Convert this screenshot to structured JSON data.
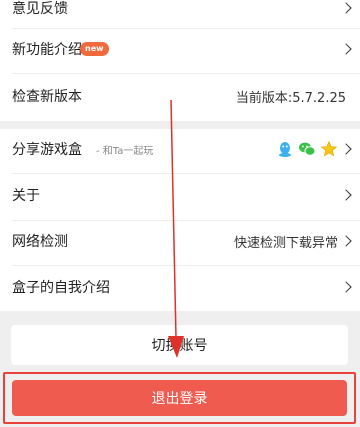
{
  "settings": {
    "feedback": {
      "label": "意见反馈"
    },
    "new_features": {
      "label": "新功能介绍",
      "badge": "new"
    },
    "check_version": {
      "label": "检查新版本",
      "value": "当前版本:5.7.2.25"
    },
    "share": {
      "label": "分享游戏盒",
      "sublabel": "- 和Ta一起玩",
      "icons": [
        "qq-icon",
        "wechat-icon",
        "star-icon"
      ]
    },
    "about": {
      "label": "关于"
    },
    "network": {
      "label": "网络检测",
      "value": "快速检测下载异常"
    },
    "intro": {
      "label": "盒子的自我介绍"
    }
  },
  "actions": {
    "switch_account": "切换账号",
    "logout": "退出登录"
  },
  "colors": {
    "background": "#efefef",
    "logout_button": "#f05b50",
    "highlight": "#e8423a",
    "new_badge": "#f06a3e",
    "qq": "#3ab0f0",
    "wechat": "#3bc04a",
    "star": "#f5c518"
  }
}
